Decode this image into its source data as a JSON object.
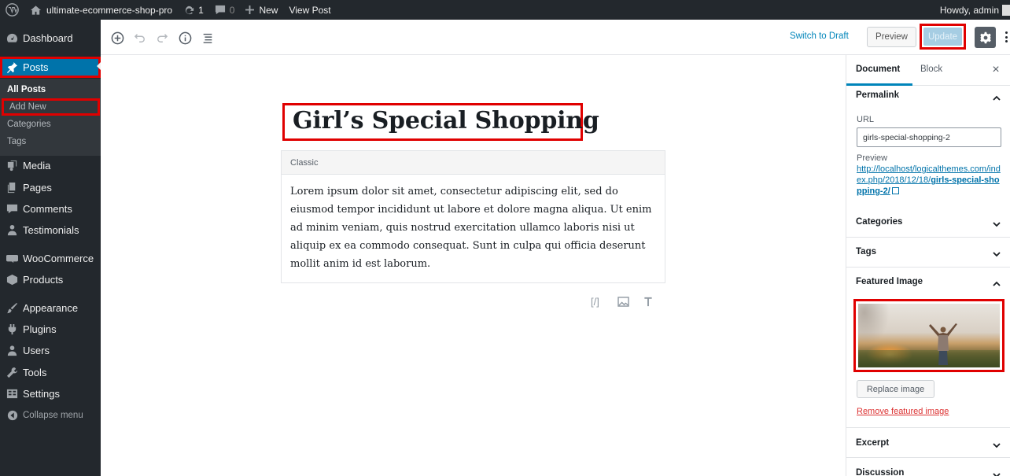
{
  "admin_bar": {
    "site_name": "ultimate-ecommerce-shop-pro",
    "updates_count": "1",
    "comments_count": "0",
    "new_label": "New",
    "view_post_label": "View Post",
    "greeting": "Howdy, admin"
  },
  "sidebar": {
    "items": [
      {
        "label": "Dashboard",
        "icon": "dashboard-icon"
      },
      {
        "label": "Posts",
        "icon": "pin-icon"
      },
      {
        "label": "Media",
        "icon": "media-icon"
      },
      {
        "label": "Pages",
        "icon": "pages-icon"
      },
      {
        "label": "Comments",
        "icon": "comments-icon"
      },
      {
        "label": "Testimonials",
        "icon": "users-icon"
      },
      {
        "label": "WooCommerce",
        "icon": "woocommerce-icon"
      },
      {
        "label": "Products",
        "icon": "products-icon"
      },
      {
        "label": "Appearance",
        "icon": "brush-icon"
      },
      {
        "label": "Plugins",
        "icon": "plugins-icon"
      },
      {
        "label": "Users",
        "icon": "user-icon"
      },
      {
        "label": "Tools",
        "icon": "wrench-icon"
      },
      {
        "label": "Settings",
        "icon": "settings-icon"
      }
    ],
    "posts_submenu": [
      "All Posts",
      "Add New",
      "Categories",
      "Tags"
    ],
    "collapse_label": "Collapse menu"
  },
  "toolbar": {
    "switch_to_draft": "Switch to Draft",
    "preview": "Preview",
    "update": "Update"
  },
  "editor": {
    "title": "Girl’s Special Shopping",
    "classic_label": "Classic",
    "body": "Lorem ipsum dolor sit amet, consectetur adipiscing elit, sed do eiusmod tempor incididunt ut labore et dolore magna aliqua. Ut enim ad minim veniam, quis nostrud exercitation ullamco laboris nisi ut aliquip ex ea commodo consequat. Sunt in culpa qui officia deserunt mollit anim id est laborum."
  },
  "panel": {
    "tab_document": "Document",
    "tab_block": "Block",
    "close": "×",
    "permalink": "Permalink",
    "url_label": "URL",
    "url_value": "girls-special-shopping-2",
    "preview_label": "Preview",
    "preview_link_prefix": "http://localhost/logicalthemes.com/index.php/2018/12/18/",
    "preview_link_slug": "girls-special-shopping-2/",
    "categories": "Categories",
    "tags": "Tags",
    "featured_image": "Featured Image",
    "replace_image": "Replace image",
    "remove_featured_image": "Remove featured image",
    "excerpt": "Excerpt",
    "discussion": "Discussion"
  },
  "colors": {
    "admin_dark": "#23282d",
    "accent_blue": "#0073aa",
    "highlight_red": "#e00000",
    "update_disabled": "#a6cde3"
  }
}
